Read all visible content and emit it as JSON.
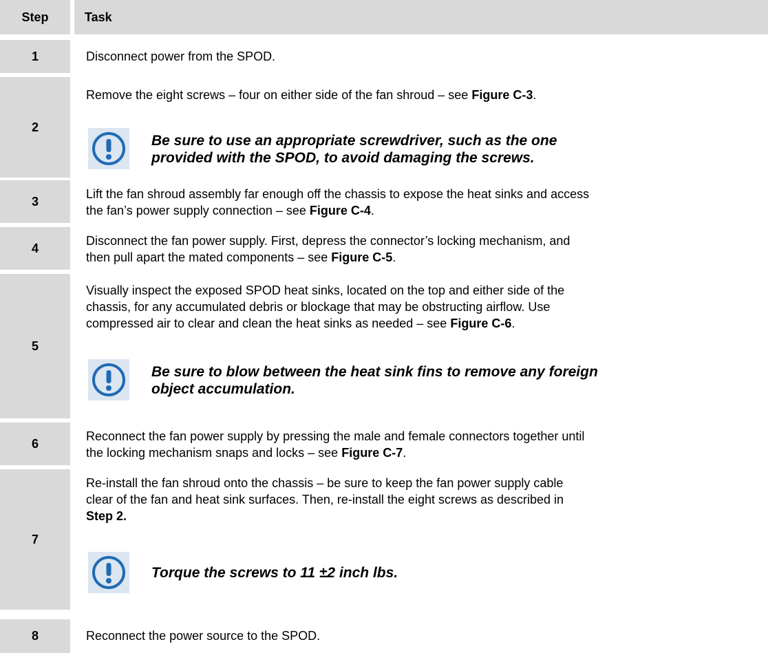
{
  "table": {
    "headers": {
      "step": "Step",
      "task": "Task"
    },
    "rows": [
      {
        "step": "1",
        "lines": [
          "Disconnect power from the SPOD."
        ]
      },
      {
        "step": "2",
        "p1": {
          "pre": "Remove the eight screws – four on either side of the fan shroud – see ",
          "ref": "Figure C-3",
          "post": "."
        },
        "note": {
          "line1": "Be sure to use an appropriate screwdriver, such as the one",
          "line2": "provided with the SPOD, to avoid damaging the screws."
        }
      },
      {
        "step": "3",
        "line1": "Lift the fan shroud assembly far enough off the chassis to expose the heat sinks and access",
        "pre2": "the fan’s power supply connection – see ",
        "ref": "Figure C-4",
        "post": "."
      },
      {
        "step": "4",
        "line1": "Disconnect the fan power supply. First, depress the connector’s locking mechanism, and",
        "pre2": "then pull apart the mated components – see ",
        "ref": "Figure C-5",
        "post": "."
      },
      {
        "step": "5",
        "line1": "Visually inspect the exposed SPOD heat sinks, located on the top and either side of the",
        "line2": "chassis, for any accumulated debris or blockage that may be obstructing airflow. Use",
        "pre3": "compressed air to clear and clean the heat sinks as needed – see ",
        "ref": "Figure C-6",
        "post": ".",
        "note": {
          "line1": "Be sure to blow between the heat sink fins to remove any foreign",
          "line2": "object accumulation."
        }
      },
      {
        "step": "6",
        "line1": "Reconnect the fan power supply by pressing the male and female connectors together until",
        "pre2": "the locking mechanism snaps and locks – see ",
        "ref": "Figure C-7",
        "post": "."
      },
      {
        "step": "7",
        "line1": "Re-install the fan shroud onto the chassis – be sure to keep the fan power supply cable",
        "line2": "clear of the fan and heat sink surfaces. Then, re-install the eight screws as described in",
        "ref": "Step 2.",
        "note": {
          "line1": "Torque the screws to 11 ±2 inch lbs."
        }
      },
      {
        "step": "8",
        "lines": [
          "Reconnect the power source to the SPOD."
        ]
      }
    ]
  },
  "icon": {
    "name": "caution-exclamation-icon",
    "stroke": "#1f6bb4",
    "fill": "#dbe6f1"
  }
}
